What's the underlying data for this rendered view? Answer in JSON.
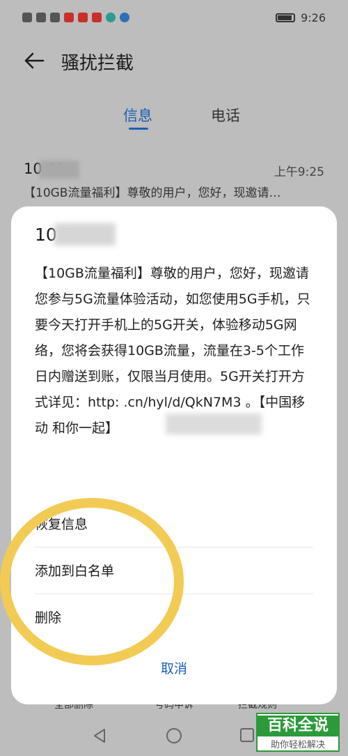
{
  "status_bar": {
    "time": "9:26",
    "left_icons": [
      "hd-icon",
      "signal-icon",
      "wifi-icon",
      "weibo-icon",
      "app-icon",
      "app-icon",
      "app-icon",
      "app-icon"
    ]
  },
  "header": {
    "title": "骚扰拦截"
  },
  "tabs": [
    {
      "label": "信息",
      "active": true
    },
    {
      "label": "电话",
      "active": false
    }
  ],
  "message": {
    "sender": "10      00",
    "time": "上午9:25",
    "preview": "【10GB流量福利】尊敬的用户，您好，现邀请…"
  },
  "dialog": {
    "sender": "10       0",
    "body": "【10GB流量福利】尊敬的用户，您好，现邀请您参与5G流量体验活动，如您使用5G手机，只要今天打开手机上的5G开关，体验移动5G网络，您将会获得10GB流量，流量在3-5个工作日内赠送到账，仅限当月使用。5G开关打开方式详见：http:                .cn/hyl/d/QkN7M3 。【中国移动 和你一起】",
    "menu": {
      "restore": "恢复信息",
      "whitelist": "添加到白名单",
      "delete": "删除"
    },
    "cancel": "取消"
  },
  "bottom_actions": [
    "全部删除",
    "号码申诉",
    "拦截规则"
  ],
  "watermark": {
    "main": "百科全说",
    "sub": "助你轻松解决"
  },
  "colors": {
    "accent": "#1a5fb4",
    "highlight": "#f2cb55",
    "watermark": "#2c9a3b"
  }
}
